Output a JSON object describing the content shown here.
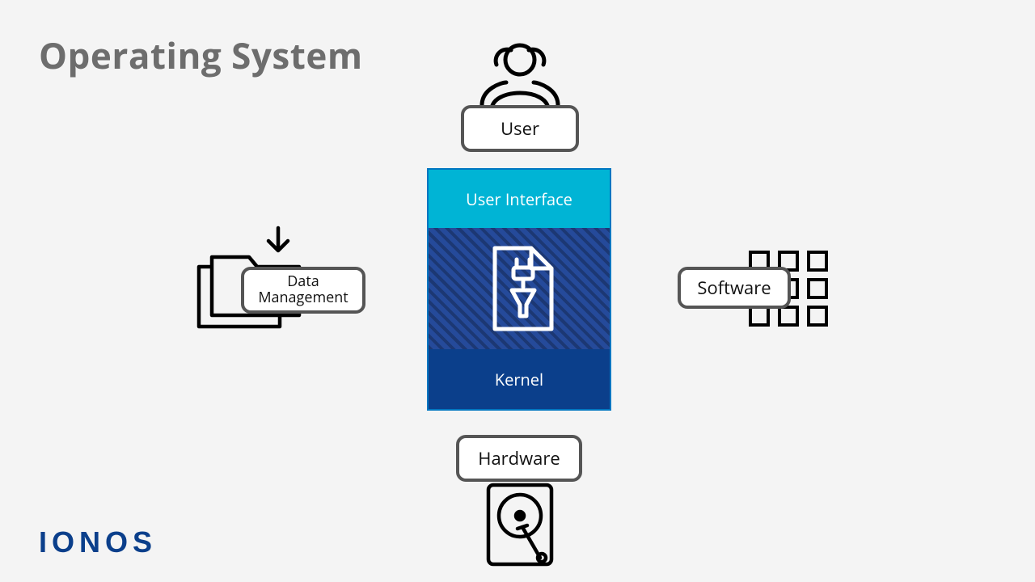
{
  "title": "Operating System",
  "brand": "IONOS",
  "pills": {
    "user": "User",
    "data": "Data\nManagement",
    "software": "Software",
    "hardware": "Hardware"
  },
  "layers": {
    "ui": "User Interface",
    "kernel": "Kernel"
  },
  "colors": {
    "ui": "#00b4d5",
    "middle": "#254a9a",
    "kernel": "#0b3f8b",
    "brand": "#0b3f8b",
    "title": "#6d6d6d",
    "pill_border": "#555555"
  }
}
